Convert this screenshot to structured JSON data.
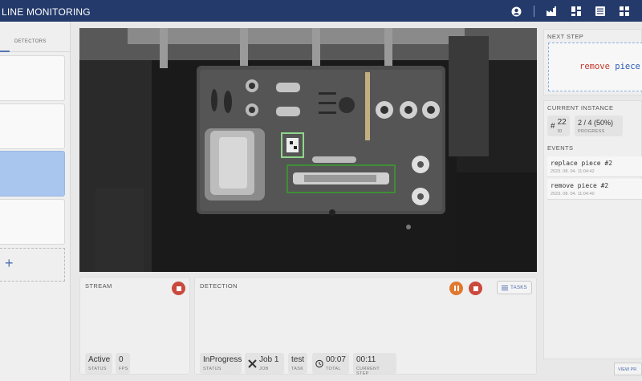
{
  "header": {
    "title": "LINE MONITORING"
  },
  "sidebar": {
    "tab_detectors": "DETECTORS",
    "add_symbol": "+"
  },
  "stream": {
    "title": "STREAM",
    "status_value": "Active",
    "status_label": "STATUS",
    "fps_value": "0",
    "fps_label": "FPS"
  },
  "detection": {
    "title": "DETECTION",
    "tasks_label": "TASKS",
    "status_value": "InProgress",
    "status_label": "STATUS",
    "job_value": "Job 1",
    "job_label": "JOB",
    "task_value": "test",
    "task_label": "TASK",
    "total_value": "00:07",
    "total_label": "TOTAL",
    "step_value": "00:11",
    "step_label": "CURRENT STEP"
  },
  "next_step": {
    "title": "NEXT STEP",
    "code_keyword": "remove",
    "code_rest": "piece"
  },
  "current_instance": {
    "title": "CURRENT INSTANCE",
    "id_value": "22",
    "id_label": "ID",
    "progress_value": "2 / 4 (50%)",
    "progress_label": "PROGRESS"
  },
  "events": {
    "title": "EVENTS",
    "items": [
      {
        "name": "replace piece #2",
        "date": "2023. 08. 04. 11:04:42"
      },
      {
        "name": "remove piece #2",
        "date": "2023. 08. 04. 11:04:40"
      }
    ]
  },
  "view_button": "VIEW PR",
  "colors": {
    "header": "#243a6b",
    "accent": "#4a6aad",
    "stop": "#c94a3c",
    "pause": "#e0782e",
    "selected_card": "#a9c6ee"
  }
}
